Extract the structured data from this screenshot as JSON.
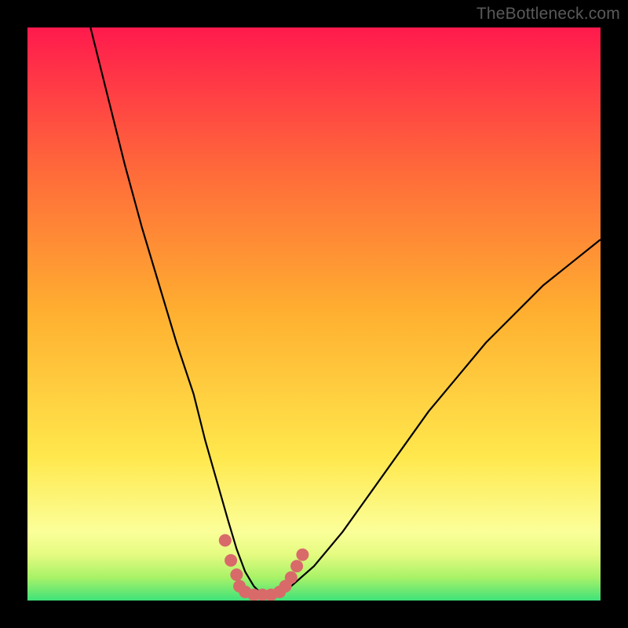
{
  "watermark": "TheBottleneck.com",
  "colors": {
    "frame": "#000000",
    "curve": "#000000",
    "marker": "#d96a6a",
    "green_band": "#3fe27a",
    "gradient_top": "#ff1a4d",
    "gradient_mid": "#ffd531",
    "gradient_yellow_pale": "#fbff99",
    "gradient_bottom": "#3fe27a"
  },
  "chart_data": {
    "type": "line",
    "title": "",
    "xlabel": "",
    "ylabel": "",
    "xlim": [
      0,
      100
    ],
    "ylim": [
      0,
      100
    ],
    "series": [
      {
        "name": "bottleneck-curve",
        "x": [
          11,
          14,
          17,
          20,
          23,
          26,
          29,
          31,
          33,
          35,
          36.5,
          38,
          39.5,
          41,
          43,
          46,
          50,
          55,
          60,
          65,
          70,
          75,
          80,
          85,
          90,
          95,
          100
        ],
        "y": [
          100,
          88,
          76,
          65,
          55,
          45,
          36,
          28,
          21,
          14,
          9,
          5,
          2.5,
          1,
          1,
          2.5,
          6,
          12,
          19,
          26,
          33,
          39,
          45,
          50,
          55,
          59,
          63
        ]
      }
    ],
    "markers": {
      "name": "bottom-markers",
      "points": [
        {
          "x": 34.5,
          "y": 10.5
        },
        {
          "x": 35.5,
          "y": 7
        },
        {
          "x": 36.5,
          "y": 4.5
        },
        {
          "x": 37,
          "y": 2.5
        },
        {
          "x": 38,
          "y": 1.5
        },
        {
          "x": 39.5,
          "y": 1
        },
        {
          "x": 41,
          "y": 1
        },
        {
          "x": 42.5,
          "y": 1
        },
        {
          "x": 44,
          "y": 1.5
        },
        {
          "x": 45,
          "y": 2.5
        },
        {
          "x": 46,
          "y": 4
        },
        {
          "x": 47,
          "y": 6
        },
        {
          "x": 48,
          "y": 8
        }
      ]
    },
    "gradient_bands": [
      {
        "y": 0,
        "color": "#3fe27a"
      },
      {
        "y": 4,
        "color": "#a8f268"
      },
      {
        "y": 8,
        "color": "#e4fb80"
      },
      {
        "y": 12,
        "color": "#fbff99"
      },
      {
        "y": 25,
        "color": "#ffe84d"
      },
      {
        "y": 50,
        "color": "#ffb030"
      },
      {
        "y": 75,
        "color": "#ff6a3a"
      },
      {
        "y": 100,
        "color": "#ff1a4d"
      }
    ]
  }
}
